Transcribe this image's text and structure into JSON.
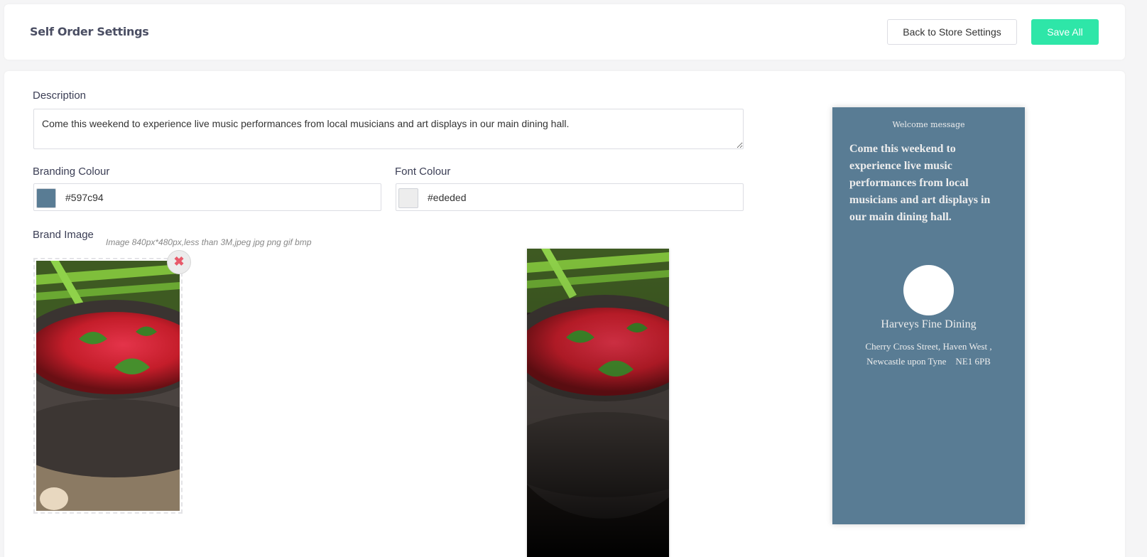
{
  "header": {
    "title": "Self Order Settings",
    "back_label": "Back to Store Settings",
    "save_label": "Save All"
  },
  "form": {
    "description_label": "Description",
    "description_value": "Come this weekend to experience live music performances from local musicians and art displays in our main dining hall.",
    "branding_label": "Branding Colour",
    "branding_value": "#597c94",
    "font_label": "Font Colour",
    "font_value": "#ededed",
    "brand_image_label": "Brand Image",
    "brand_image_hint": "Image 840px*480px,less than 3M,jpeg jpg png gif bmp",
    "remove_icon": "✖"
  },
  "preview": {
    "welcome": "Welcome message",
    "message": "Come this weekend to experience live music performances from local musicians and art displays in our main dining hall.",
    "store_name": "Harveys Fine Dining",
    "address_line1": "Cherry Cross Street, Haven West ,",
    "address_line2": "Newcastle upon Tyne    NE1 6PB"
  },
  "colors": {
    "branding": "#597c94",
    "font": "#ededed",
    "accent": "#2ee6a8"
  }
}
